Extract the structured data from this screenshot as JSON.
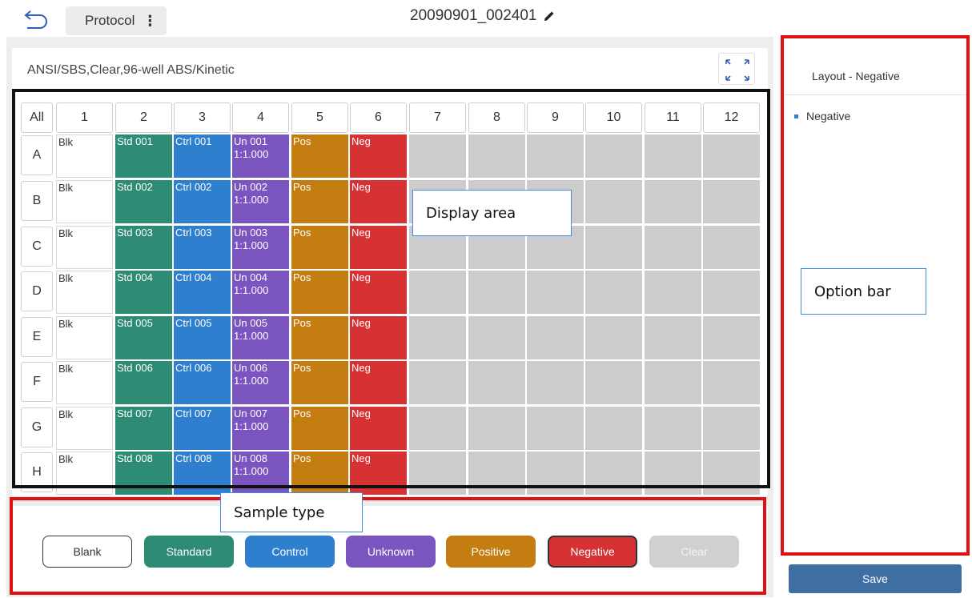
{
  "header": {
    "protocol_label": "Protocol",
    "file_name": "20090901_002401"
  },
  "plate": {
    "info": "ANSI/SBS,Clear,96-well   ABS/Kinetic",
    "all_label": "All",
    "columns": [
      "1",
      "2",
      "3",
      "4",
      "5",
      "6",
      "7",
      "8",
      "9",
      "10",
      "11",
      "12"
    ],
    "rows": [
      "A",
      "B",
      "C",
      "D",
      "E",
      "F",
      "G",
      "H"
    ],
    "blank_label": "Blk",
    "standards": [
      "Std 001",
      "Std 002",
      "Std 003",
      "Std 004",
      "Std 005",
      "Std 006",
      "Std 007",
      "Std 008"
    ],
    "controls": [
      "Ctrl 001",
      "Ctrl 002",
      "Ctrl 003",
      "Ctrl 004",
      "Ctrl 005",
      "Ctrl 006",
      "Ctrl 007",
      "Ctrl 008"
    ],
    "unknowns": [
      "Un 001",
      "Un 002",
      "Un 003",
      "Un 004",
      "Un 005",
      "Un 006",
      "Un 007",
      "Un 008"
    ],
    "dilution": "1:1.000",
    "positive_label": "Pos",
    "negative_label": "Neg"
  },
  "annotations": {
    "display_area": "Display area",
    "option_bar": "Option bar",
    "sample_type": "Sample type"
  },
  "sample_types": [
    {
      "name": "blank",
      "label": "Blank"
    },
    {
      "name": "standard",
      "label": "Standard"
    },
    {
      "name": "control",
      "label": "Control"
    },
    {
      "name": "unknown",
      "label": "Unknown"
    },
    {
      "name": "positive",
      "label": "Positive"
    },
    {
      "name": "negative",
      "label": "Negative"
    },
    {
      "name": "clear",
      "label": "Clear"
    }
  ],
  "option_bar": {
    "title": "Layout - Negative",
    "items": [
      "Negative"
    ],
    "save_label": "Save"
  },
  "colors": {
    "blank": "#ffffff",
    "standard": "#2e8b74",
    "control": "#2f7fcf",
    "unknown": "#7a55c0",
    "positive": "#c47d11",
    "negative": "#d63234",
    "empty": "#cccccc",
    "clear": "#d0d0d0",
    "save": "#3f6fa2"
  }
}
